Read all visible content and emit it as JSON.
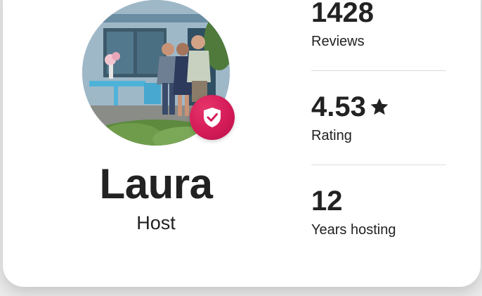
{
  "host": {
    "name": "Laura",
    "role": "Host",
    "verified_badge_color": "#d41b58"
  },
  "stats": [
    {
      "value": "1428",
      "label": "Reviews"
    },
    {
      "value": "4.53",
      "label": "Rating",
      "icon": "star-icon"
    },
    {
      "value": "12",
      "label": "Years hosting"
    }
  ],
  "colors": {
    "text": "#222222",
    "divider": "#dddddd",
    "badge": "#d41b58"
  }
}
